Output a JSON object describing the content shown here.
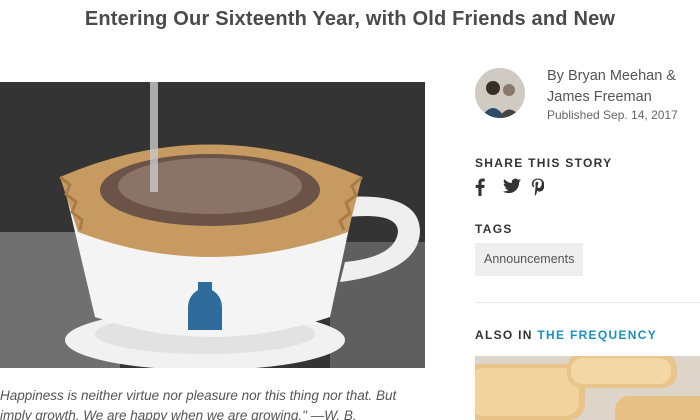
{
  "article": {
    "title": "Entering Our Sixteenth Year, with Old Friends and New",
    "quote": "Happiness is neither virtue nor pleasure nor this thing nor that. But\nimply growth. We are happy when we are growing.\" —W. B."
  },
  "author": {
    "byline": "By Bryan Meehan &\nJames Freeman",
    "published": "Published Sep. 14, 2017"
  },
  "share": {
    "label": "SHARE THIS STORY",
    "icons": [
      "facebook-icon",
      "twitter-icon",
      "pinterest-icon"
    ]
  },
  "tags": {
    "label": "TAGS",
    "items": [
      "Announcements"
    ]
  },
  "also_in": {
    "prefix": "ALSO IN",
    "link": "THE FREQUENCY"
  },
  "colors": {
    "accent": "#1a8fc6",
    "text": "#333333",
    "chip_bg": "#eeeeee"
  }
}
